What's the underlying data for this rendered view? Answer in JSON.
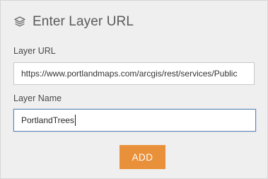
{
  "header": {
    "icon": "layers-icon",
    "title": "Enter Layer URL"
  },
  "form": {
    "layer_url": {
      "label": "Layer URL",
      "value": "https://www.portlandmaps.com/arcgis/rest/services/Public"
    },
    "layer_name": {
      "label": "Layer Name",
      "value": "PortlandTrees"
    },
    "add_label": "ADD"
  },
  "colors": {
    "panel_bg": "#efefef",
    "add_button": "#e9903a",
    "focus_border": "#5b87b6"
  }
}
